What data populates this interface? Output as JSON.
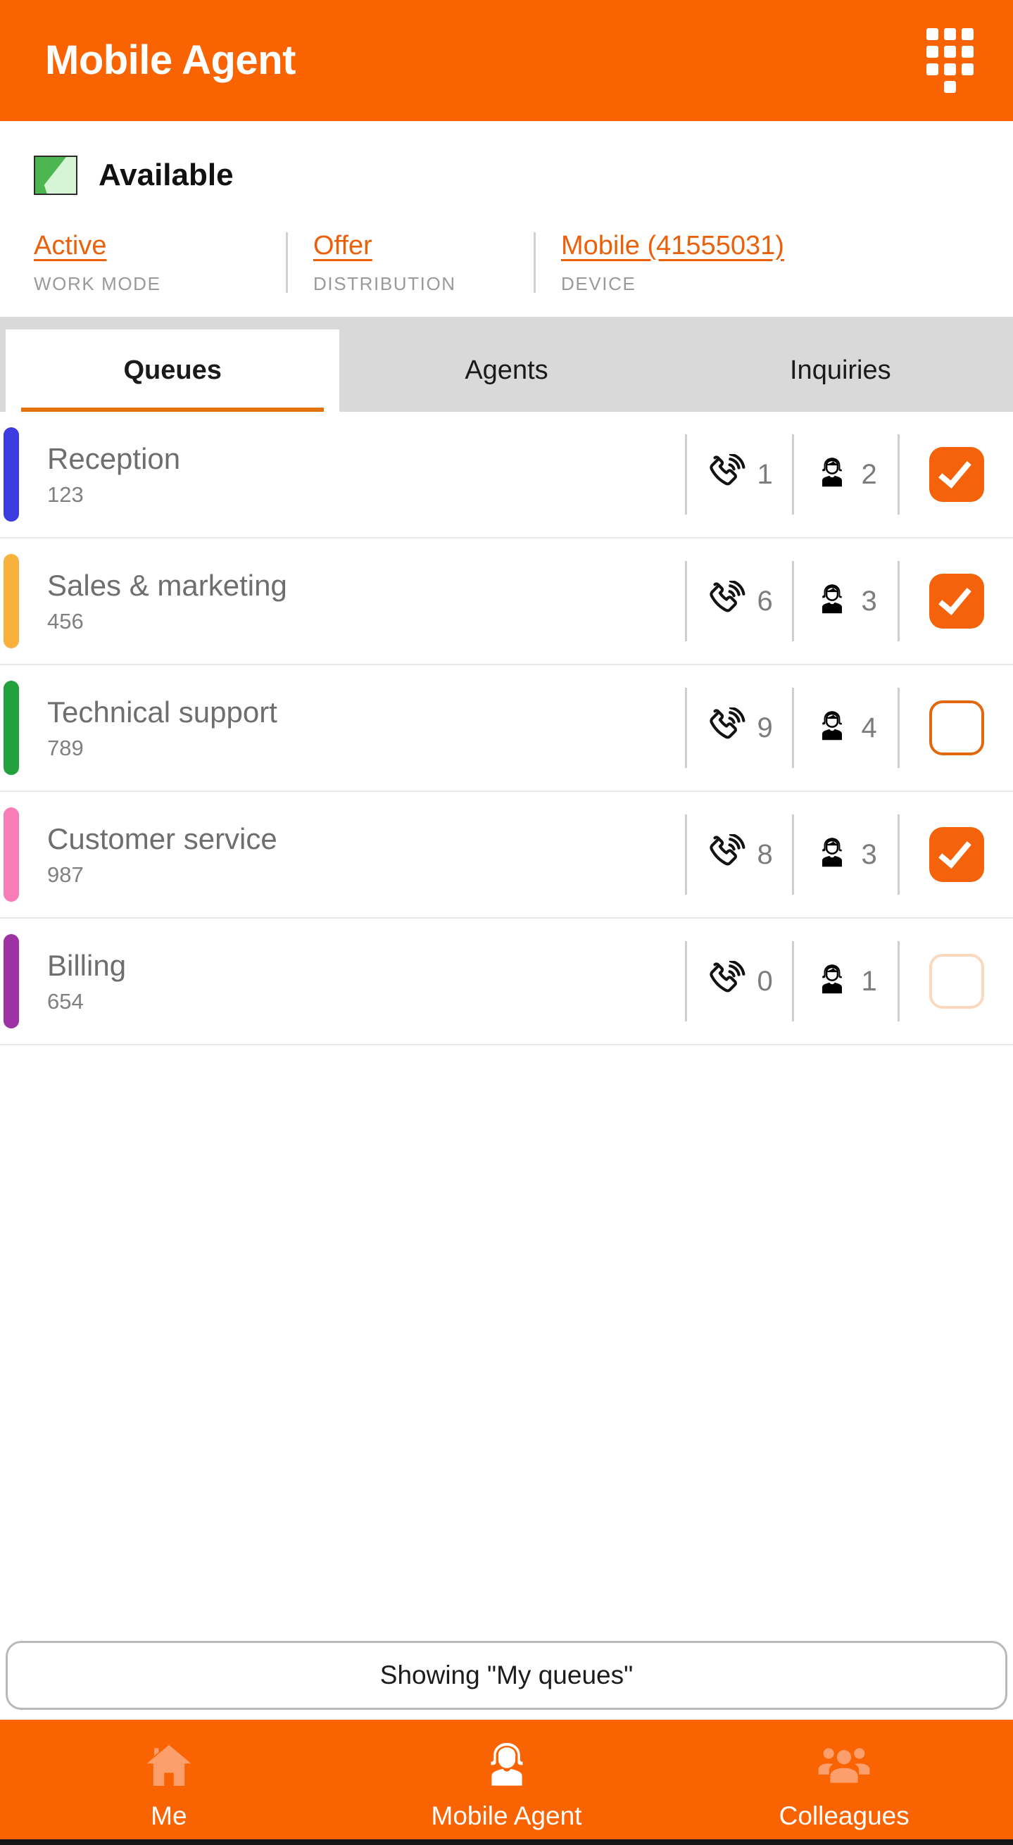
{
  "header": {
    "title": "Mobile Agent",
    "dialpad_icon": "dialpad-icon"
  },
  "status": {
    "label": "Available",
    "icon": "availability-swatch-icon"
  },
  "mode_strip": [
    {
      "value": "Active",
      "caption": "WORK MODE",
      "name": "work-mode"
    },
    {
      "value": "Offer",
      "caption": "DISTRIBUTION",
      "name": "distribution"
    },
    {
      "value": "Mobile (41555031)",
      "caption": "DEVICE",
      "name": "device"
    }
  ],
  "tabs": [
    {
      "label": "Queues",
      "active": true
    },
    {
      "label": "Agents",
      "active": false
    },
    {
      "label": "Inquiries",
      "active": false
    }
  ],
  "queues": [
    {
      "name": "Reception",
      "number": "123",
      "color": "#3b3bdf",
      "calls": "1",
      "agents": "2",
      "checked": "on"
    },
    {
      "name": "Sales & marketing",
      "number": "456",
      "color": "#f8b13c",
      "calls": "6",
      "agents": "3",
      "checked": "on"
    },
    {
      "name": "Technical support",
      "number": "789",
      "color": "#22a13c",
      "calls": "9",
      "agents": "4",
      "checked": "off"
    },
    {
      "name": "Customer service",
      "number": "987",
      "color": "#f87cb6",
      "calls": "8",
      "agents": "3",
      "checked": "on"
    },
    {
      "name": "Billing",
      "number": "654",
      "color": "#9c32a4",
      "calls": "0",
      "agents": "1",
      "checked": "disabled"
    }
  ],
  "showing": {
    "label": "Showing \"My queues\""
  },
  "bottom_nav": [
    {
      "label": "Me",
      "icon": "home-icon",
      "active": false
    },
    {
      "label": "Mobile Agent",
      "icon": "headset-agent-icon",
      "active": true
    },
    {
      "label": "Colleagues",
      "icon": "people-group-icon",
      "active": false
    }
  ],
  "colors": {
    "brand_orange": "#f96302",
    "tab_underline": "#e2710e",
    "checkbox_on": "#f4620b",
    "checkbox_off_border": "#e2680e",
    "checkbox_disabled_border": "#fbd9bf",
    "link_orange": "#ea600b",
    "tabbar_bg": "#d9d9d9",
    "queue_name_gray": "#6e6e6e"
  }
}
